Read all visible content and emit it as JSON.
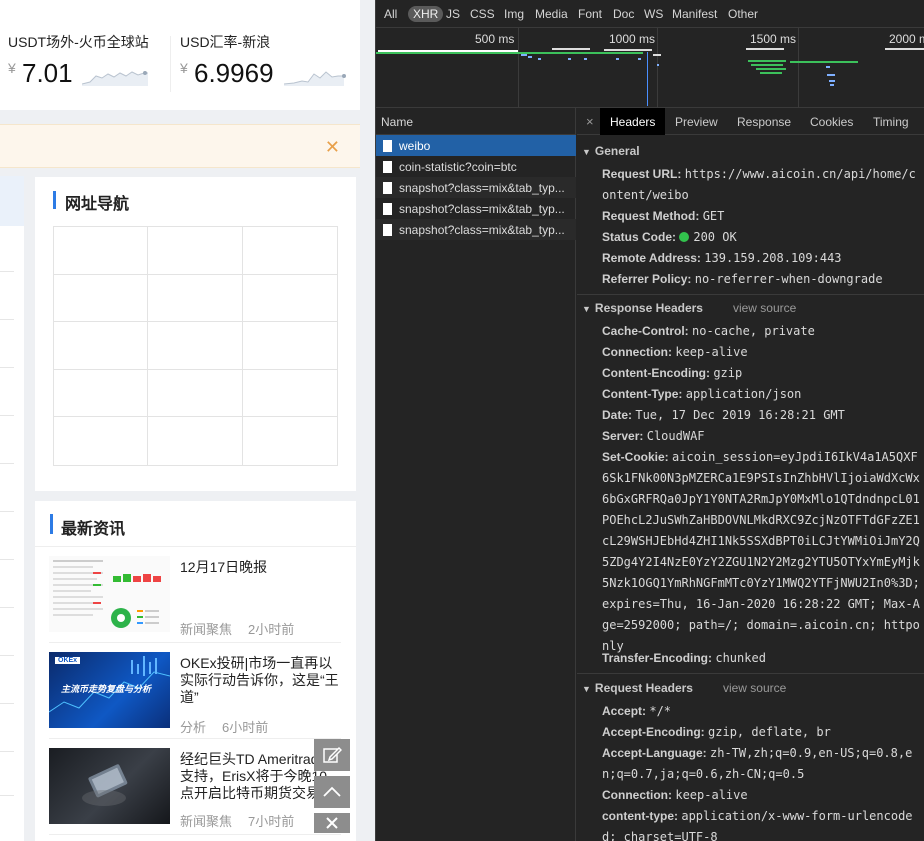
{
  "left": {
    "rates": [
      {
        "title": "USDT场外-火币全球站",
        "currency": "¥",
        "value": "7.01"
      },
      {
        "title": "USD汇率-新浪",
        "currency": "¥",
        "value": "6.9969"
      }
    ],
    "alert_close": "✕",
    "nav_card_title": "网址导航",
    "news_card_title": "最新资讯",
    "news": [
      {
        "headline": "12月17日晚报",
        "source": "新闻聚焦",
        "time": "2小时前"
      },
      {
        "headline": "OKEx投研|市场一直再以实际行动告诉你，这是“王道”",
        "source": "分析",
        "time": "6小时前",
        "thumb_text": "主流币走势复盘与分析",
        "thumb_badge": "OKEx"
      },
      {
        "headline": "经纪巨头TD Ameritrade支持，ErisX将于今晚10点开启比特币期货交易",
        "source": "新闻聚焦",
        "time": "7小时前"
      }
    ]
  },
  "dev": {
    "filters": [
      "All",
      "XHR",
      "JS",
      "CSS",
      "Img",
      "Media",
      "Font",
      "Doc",
      "WS",
      "Manifest",
      "Other"
    ],
    "active_filter": "XHR",
    "timeline_ticks": [
      "500 ms",
      "1000 ms",
      "1500 ms",
      "2000 m"
    ],
    "name_header": "Name",
    "requests": [
      "weibo",
      "coin-statistic?coin=btc",
      "snapshot?class=mix&tab_typ...",
      "snapshot?class=mix&tab_typ...",
      "snapshot?class=mix&tab_typ..."
    ],
    "tab_close": "×",
    "tabs": [
      "Headers",
      "Preview",
      "Response",
      "Cookies",
      "Timing"
    ],
    "active_tab": "Headers",
    "general_title": "General",
    "general": [
      {
        "k": "Request URL:",
        "v": "https://www.aicoin.cn/api/home/content/weibo"
      },
      {
        "k": "Request Method:",
        "v": "GET"
      },
      {
        "k": "Status Code:",
        "v": "200 OK"
      },
      {
        "k": "Remote Address:",
        "v": "139.159.208.109:443"
      },
      {
        "k": "Referrer Policy:",
        "v": "no-referrer-when-downgrade"
      }
    ],
    "response_title": "Response Headers",
    "view_source": "view source",
    "response": [
      {
        "k": "Cache-Control:",
        "v": "no-cache, private"
      },
      {
        "k": "Connection:",
        "v": "keep-alive"
      },
      {
        "k": "Content-Encoding:",
        "v": "gzip"
      },
      {
        "k": "Content-Type:",
        "v": "application/json"
      },
      {
        "k": "Date:",
        "v": "Tue, 17 Dec 2019 16:28:21 GMT"
      },
      {
        "k": "Server:",
        "v": "CloudWAF"
      },
      {
        "k": "Set-Cookie:",
        "v": "aicoin_session=eyJpdiI6IkV4a1A5QXF6Sk1FNk00N3pMZERCa1E9PSIsInZhbHVlIjoiaWdXcWx6bGxGRFRQa0JpY1Y0NTA2RmJpY0MxMlo1QTdndnpcL01POEhcL2JuSWhZaHBDOVNLMkdRXC9ZcjNzOTFTdGFzZE1cL29WSHJEbHd4ZHI1Nk5SSXdBPT0iLCJtYWMiOiJmY2Q5ZDg4Y2I4NzE0YzY2ZGU1N2Y2Mzg2YTU5OTYxYmEyMjk5Nzk1OGQ1YmRhNGFmMTc0YzY1MWQ2YTFjNWU2In0%3D; expires=Thu, 16-Jan-2020 16:28:22 GMT; Max-Age=2592000; path=/; domain=.aicoin.cn; httponly"
      },
      {
        "k": "Transfer-Encoding:",
        "v": "chunked"
      }
    ],
    "request_title": "Request Headers",
    "request": [
      {
        "k": "Accept:",
        "v": "*/*"
      },
      {
        "k": "Accept-Encoding:",
        "v": "gzip, deflate, br"
      },
      {
        "k": "Accept-Language:",
        "v": "zh-TW,zh;q=0.9,en-US;q=0.8,en;q=0.7,ja;q=0.6,zh-CN;q=0.5"
      },
      {
        "k": "Connection:",
        "v": "keep-alive"
      },
      {
        "k": "content-type:",
        "v": "application/x-www-form-urlencoded; charset=UTF-8"
      }
    ],
    "status_color": "#32c24d",
    "selected_color": "#2261a6"
  }
}
